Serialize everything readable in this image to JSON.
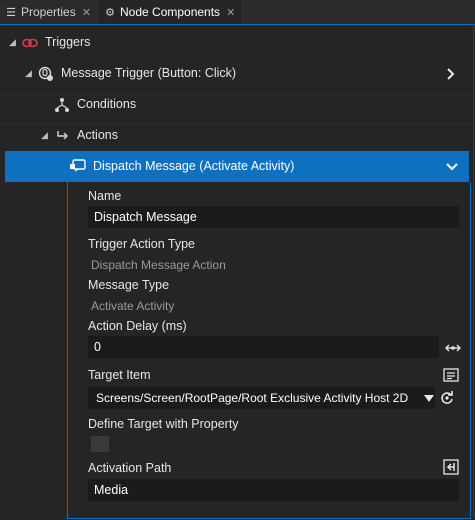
{
  "tabs": [
    {
      "label": "Properties",
      "icon": "list-icon",
      "close": "✕"
    },
    {
      "label": "Node Components",
      "icon": "node-components-icon",
      "close": "✕"
    }
  ],
  "tree": {
    "triggers_label": "Triggers",
    "message_trigger_label": "Message Trigger (Button: Click)",
    "conditions_label": "Conditions",
    "actions_label": "Actions",
    "dispatch_label": "Dispatch Message (Activate Activity)"
  },
  "properties": {
    "name_label": "Name",
    "name_value": "Dispatch Message",
    "trigger_action_type_label": "Trigger Action Type",
    "trigger_action_type_value": "Dispatch Message Action",
    "message_type_label": "Message Type",
    "message_type_value": "Activate Activity",
    "action_delay_label": "Action Delay (ms)",
    "action_delay_value": "0",
    "target_item_label": "Target Item",
    "target_item_value": "Screens/Screen/RootPage/Root Exclusive Activity Host 2D",
    "define_target_label": "Define Target with Property",
    "activation_path_label": "Activation Path",
    "activation_path_value": "Media"
  },
  "colors": {
    "accent": "#0e70c0",
    "background": "#252526",
    "trigger_icon": "#e0384a"
  }
}
